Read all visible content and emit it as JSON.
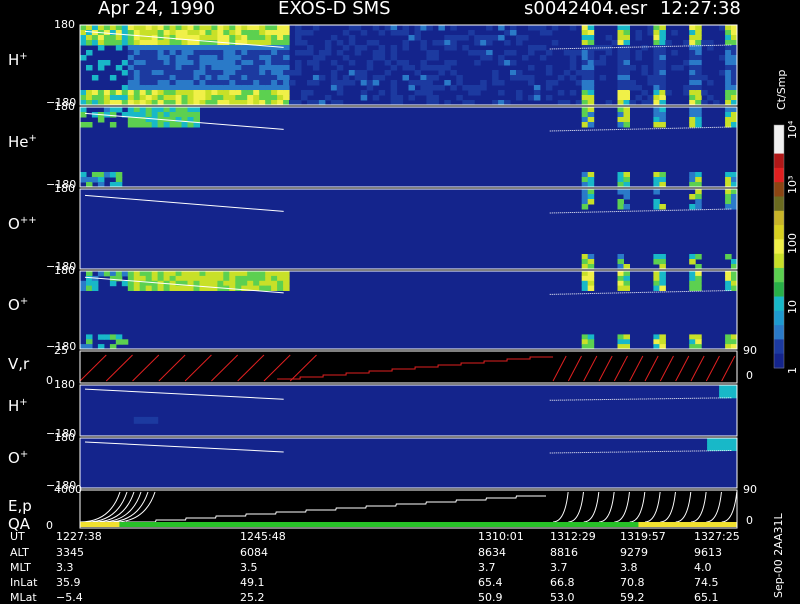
{
  "header": {
    "date": "Apr 24, 1990",
    "instrument": "EXOS-D SMS",
    "file": "s0042404.esr",
    "time": "12:27:38"
  },
  "colorbar": {
    "unit": "Ct/Smp",
    "tick_labels": [
      "10⁴",
      "10³",
      "100",
      "10",
      "1"
    ]
  },
  "chart_data": {
    "type": "heatmap",
    "panels": [
      {
        "label": "H+",
        "label_base": "H",
        "label_sup": "+",
        "ymax": "180",
        "ymin": "−180"
      },
      {
        "label": "He+",
        "label_base": "He",
        "label_sup": "+",
        "ymax": "180",
        "ymin": "−180"
      },
      {
        "label": "O++",
        "label_base": "O",
        "label_sup": "++",
        "ymax": "180",
        "ymin": "−180"
      },
      {
        "label": "O+",
        "label_base": "O",
        "label_sup": "+",
        "ymax": "180",
        "ymin": "−180"
      },
      {
        "label": "V,r",
        "ymax": "25",
        "ymin": "0",
        "right_top": "90",
        "right_bottom": "0"
      },
      {
        "label": "H+",
        "label_base": "H",
        "label_sup": "+",
        "ymax": "180",
        "ymin": "−180"
      },
      {
        "label": "O+",
        "label_base": "O",
        "label_sup": "+",
        "ymax": "180",
        "ymin": "−180"
      },
      {
        "label": "E,p",
        "label2": "QA",
        "ymax": "4000",
        "ymin": "0",
        "right_top": "90",
        "right_bottom": "0"
      }
    ],
    "ephemeris": {
      "row_labels": [
        "UT",
        "ALT",
        "MLT",
        "InLat",
        "MLat"
      ],
      "columns": [
        {
          "UT": "1227:38",
          "ALT": "3345",
          "MLT": "3.3",
          "InLat": "35.9",
          "MLat": "−5.4"
        },
        {
          "UT": "1245:48",
          "ALT": "6084",
          "MLT": "3.5",
          "InLat": "49.1",
          "MLat": "25.2"
        },
        {
          "UT": "1310:01",
          "ALT": "8634",
          "MLT": "3.7",
          "InLat": "65.4",
          "MLat": "50.9"
        },
        {
          "UT": "1312:29",
          "ALT": "8816",
          "MLT": "3.7",
          "InLat": "66.8",
          "MLat": "53.0"
        },
        {
          "UT": "1319:57",
          "ALT": "9279",
          "MLT": "3.8",
          "InLat": "70.8",
          "MLat": "59.2"
        },
        {
          "UT": "1327:25",
          "ALT": "9613",
          "MLT": "4.0",
          "InLat": "74.5",
          "MLat": "65.1"
        }
      ]
    },
    "side_note": "Sep-00  2AA31L"
  }
}
